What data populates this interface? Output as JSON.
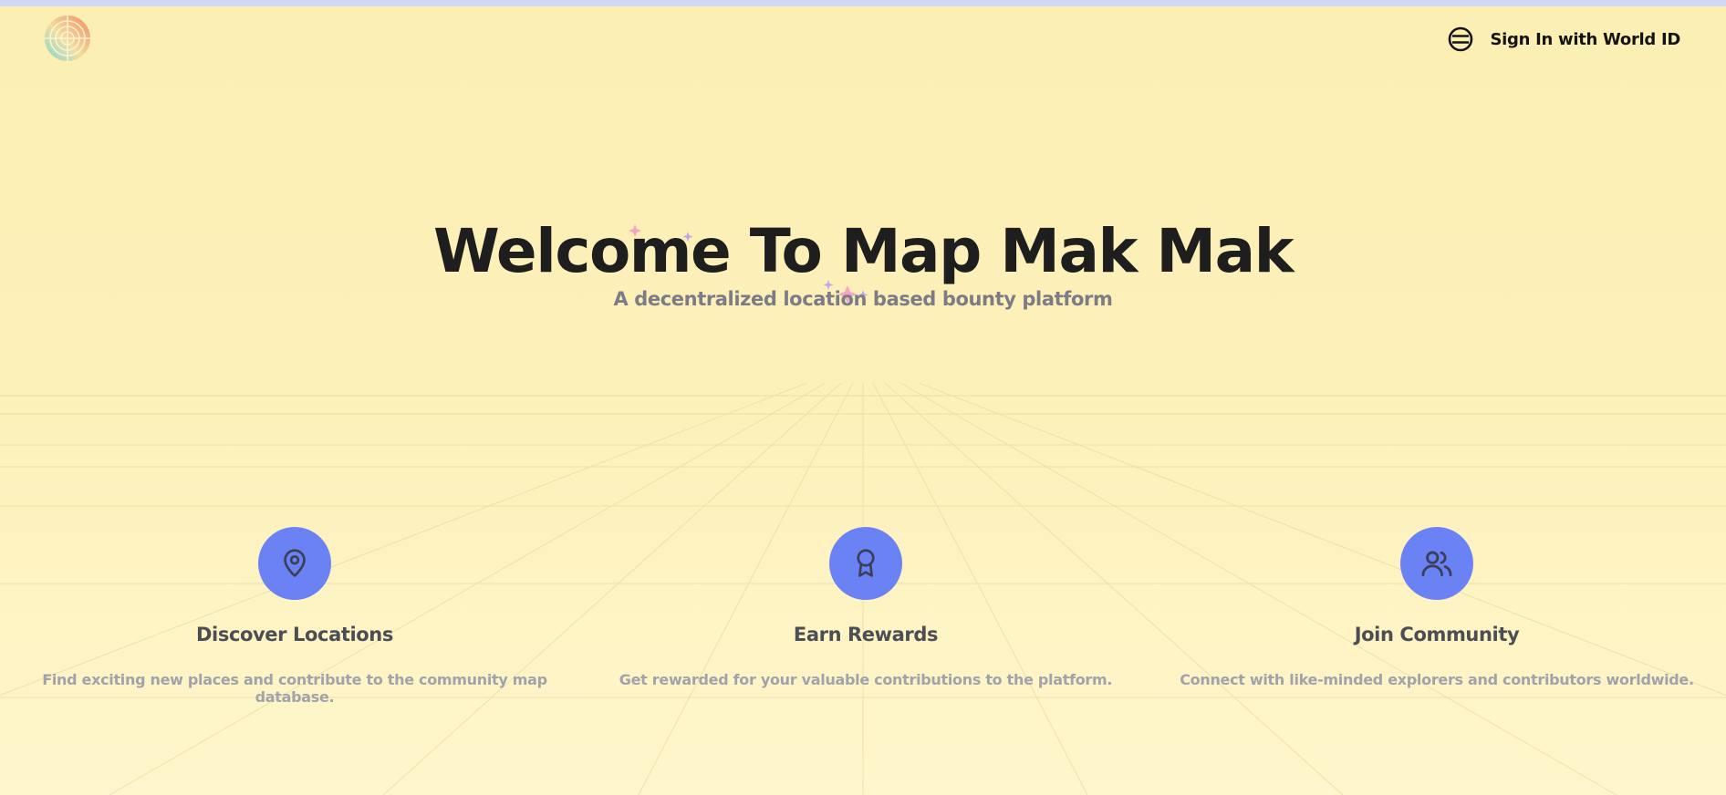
{
  "header": {
    "logo_icon": "globe-logo-icon",
    "signin_icon": "world-id-icon",
    "signin_label": "Sign In with World ID"
  },
  "hero": {
    "title": "Welcome To Map Mak Mak",
    "subtitle": "A decentralized location based bounty platform"
  },
  "features": [
    {
      "icon": "map-pin-icon",
      "title": "Discover Locations",
      "description": "Find exciting new places and contribute to the community map database."
    },
    {
      "icon": "award-icon",
      "title": "Earn Rewards",
      "description": "Get rewarded for your valuable contributions to the platform."
    },
    {
      "icon": "users-icon",
      "title": "Join Community",
      "description": "Connect with like-minded explorers and contributors worldwide."
    }
  ],
  "colors": {
    "background": "#fcefb3",
    "accent": "#6b82f5",
    "title": "#1e1e1e",
    "muted_text": "#a2a2ab",
    "top_strip": "#cfd9f5"
  }
}
